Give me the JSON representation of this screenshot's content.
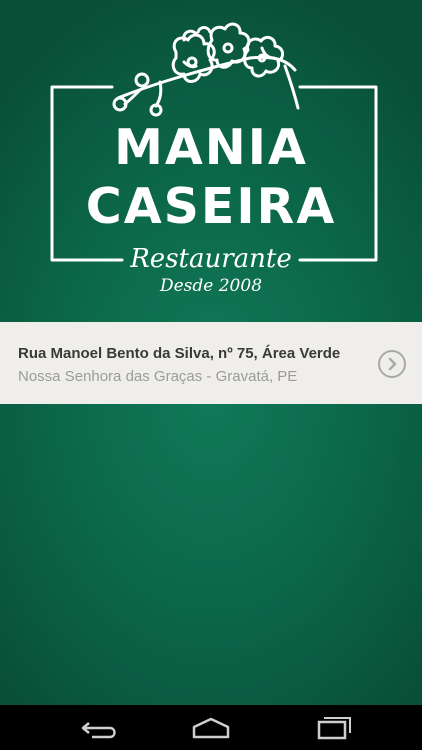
{
  "logo": {
    "line1": "MANIA",
    "line2": "CASEIRA",
    "subtitle": "Restaurante",
    "since": "Desde 2008"
  },
  "address": {
    "street": "Rua Manoel Bento da Silva, nº 75, Área Verde",
    "city": "Nossa Senhora das Graças - Gravatá, PE"
  },
  "icons": {
    "address_action": "chevron-right-circle-icon",
    "nav_back": "back-icon",
    "nav_home": "home-icon",
    "nav_recents": "recent-apps-icon"
  },
  "colors": {
    "background": "#0c6a4b",
    "address_bar": "#efeeeb",
    "address_primary": "#3a3a3a",
    "address_secondary": "#9b9b9b",
    "navbar": "#000000"
  }
}
